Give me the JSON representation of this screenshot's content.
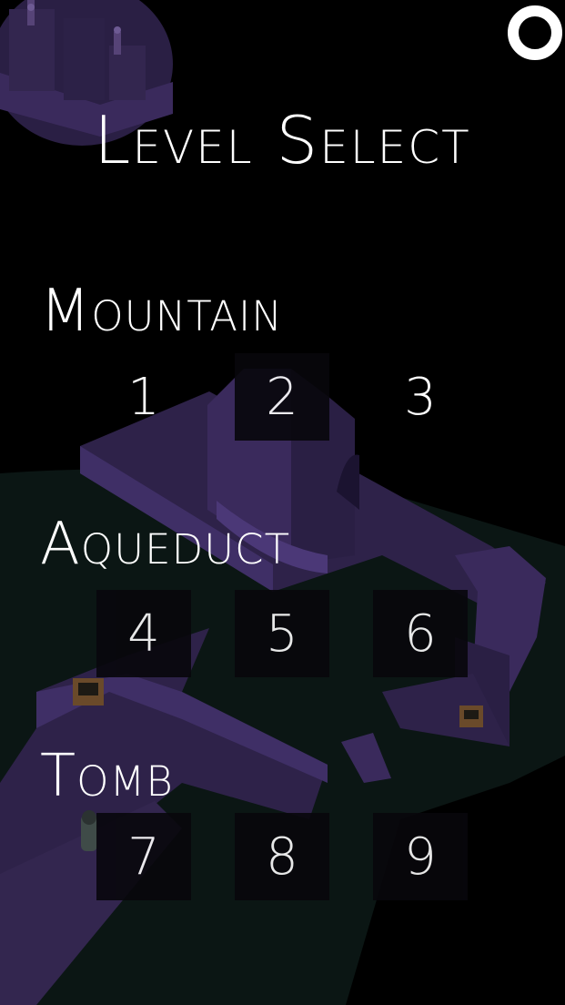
{
  "title": "Level Select",
  "colors": {
    "background": "#000000",
    "stone": "#3a2a5c",
    "stone_light": "#4b3877",
    "ground": "#0b1614",
    "tile": "#08070c",
    "text": "#ffffff"
  },
  "icons": {
    "menu": "ring-icon"
  },
  "sections": [
    {
      "name": "Mountain",
      "levels": [
        "1",
        "2",
        "3"
      ]
    },
    {
      "name": "Aqueduct",
      "levels": [
        "4",
        "5",
        "6"
      ]
    },
    {
      "name": "Tomb",
      "levels": [
        "7",
        "8",
        "9"
      ]
    }
  ]
}
